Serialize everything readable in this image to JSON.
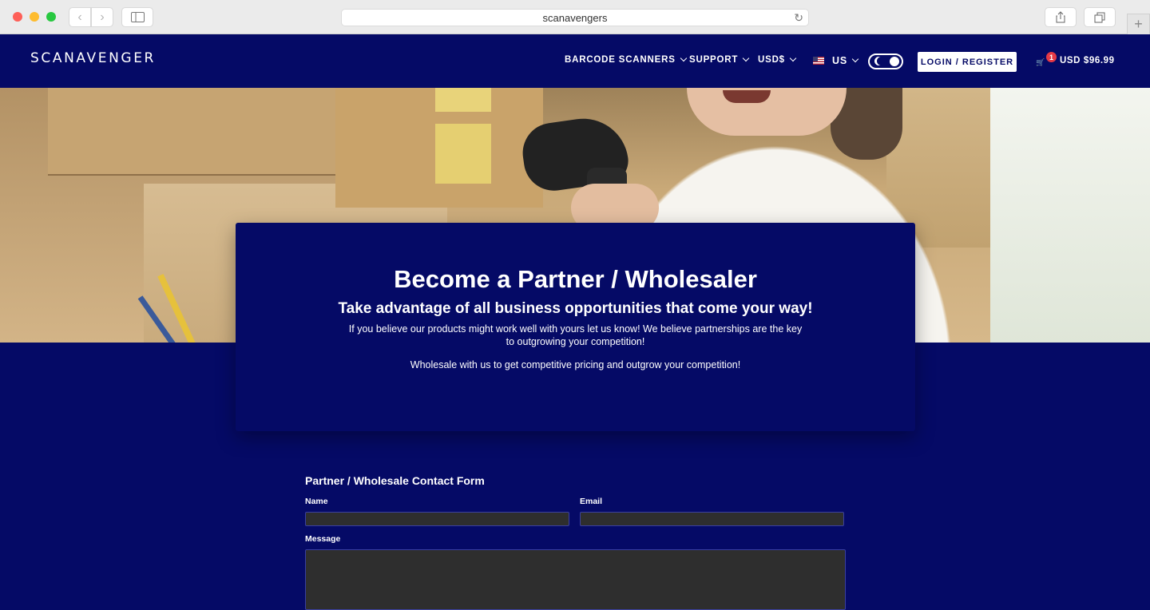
{
  "browser": {
    "url": "scanavengers"
  },
  "header": {
    "logo": "SCANAVENGER",
    "nav": {
      "barcode_scanners": "BARCODE SCANNERS",
      "support": "SUPPORT",
      "currency": "USD$",
      "region": "US"
    },
    "login_label": "LOGIN / REGISTER",
    "cart": {
      "count": "1",
      "total": "USD $96.99"
    }
  },
  "hero_card": {
    "title": "Become a Partner / Wholesaler",
    "subtitle": "Take advantage of all business opportunities that come your way!",
    "text": "If you believe our products might work well with yours let us know! We believe partnerships are the key to outgrowing your competition!",
    "text2": "Wholesale with us to get competitive pricing and outgrow your competition!"
  },
  "form": {
    "title": "Partner / Wholesale Contact Form",
    "name_label": "Name",
    "email_label": "Email",
    "message_label": "Message",
    "name_value": "",
    "email_value": "",
    "message_value": ""
  },
  "colors": {
    "brand_navy": "#050a66",
    "badge_red": "#e53946",
    "input_bg": "#2e2e2e"
  }
}
